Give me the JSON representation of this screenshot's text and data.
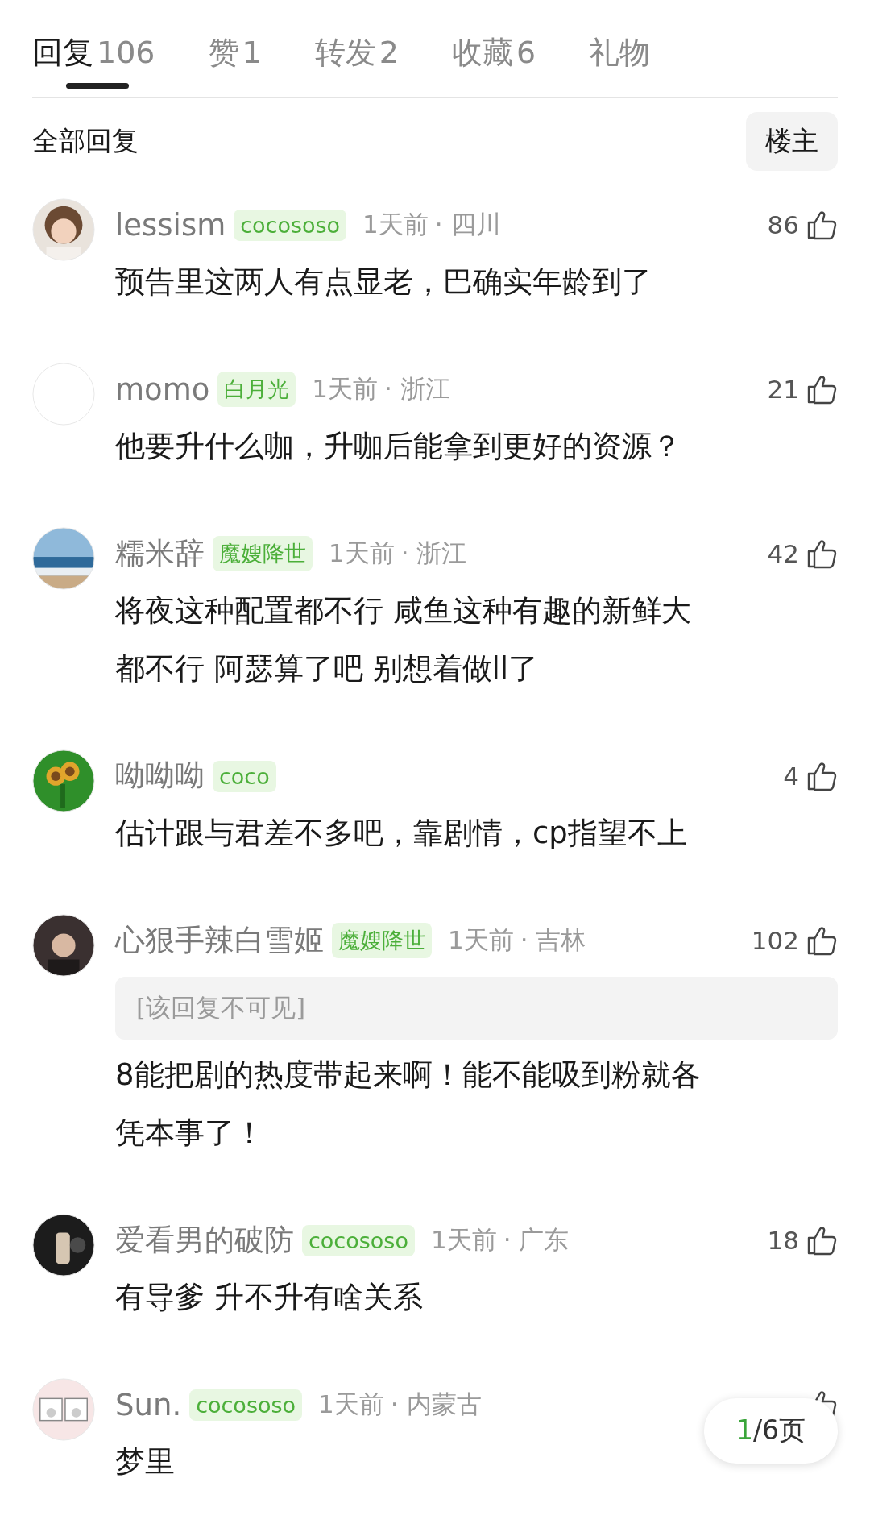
{
  "tabs": [
    {
      "label": "回复",
      "count": "106",
      "selected": true
    },
    {
      "label": "赞",
      "count": "1",
      "selected": false
    },
    {
      "label": "转发",
      "count": "2",
      "selected": false
    },
    {
      "label": "收藏",
      "count": "6",
      "selected": false
    },
    {
      "label": "礼物",
      "selected": false
    }
  ],
  "section_title": "全部回复",
  "filter_button": "楼主",
  "comments": [
    {
      "name": "lessism",
      "badge": "cocososo",
      "time": "1天前",
      "location": "· 四川",
      "likes": "86",
      "lines": [
        "预告里这两人有点显老，巴确实年龄到了"
      ]
    },
    {
      "name": "momo",
      "badge": "白月光",
      "time": "1天前",
      "location": "· 浙江",
      "likes": "21",
      "lines": [
        "他要升什么咖，升咖后能拿到更好的资源？"
      ]
    },
    {
      "name": "糯米辞",
      "badge": "魔嫂降世",
      "time": "1天前",
      "location": "· 浙江",
      "likes": "42",
      "lines": [
        "将夜这种配置都不行 咸鱼这种有趣的新鲜大",
        "都不行  阿瑟算了吧 别想着做ll了"
      ]
    },
    {
      "name": "呦呦呦",
      "badge": "coco",
      "likes": "4",
      "lines": [
        "估计跟与君差不多吧，靠剧情，cp指望不上"
      ]
    },
    {
      "name": "心狠手辣白雪姬",
      "badge": "魔嫂降世",
      "time": "1天前",
      "location": "· 吉林",
      "likes": "102",
      "hidden_reply": "[该回复不可见]",
      "lines": [
        "8能把剧的热度带起来啊！能不能吸到粉就各",
        "凭本事了！"
      ]
    },
    {
      "name": "爱看男的破防",
      "badge": "cocososo",
      "time": "1天前",
      "location": "· 广东",
      "likes": "18",
      "lines": [
        "有导爹 升不升有啥关系"
      ]
    },
    {
      "name": "Sun.",
      "badge": "cocososo",
      "time": "1天前",
      "location": "· 内蒙古",
      "lines": [
        "梦里"
      ]
    }
  ],
  "pager": {
    "current": "1",
    "total": "/6页"
  }
}
